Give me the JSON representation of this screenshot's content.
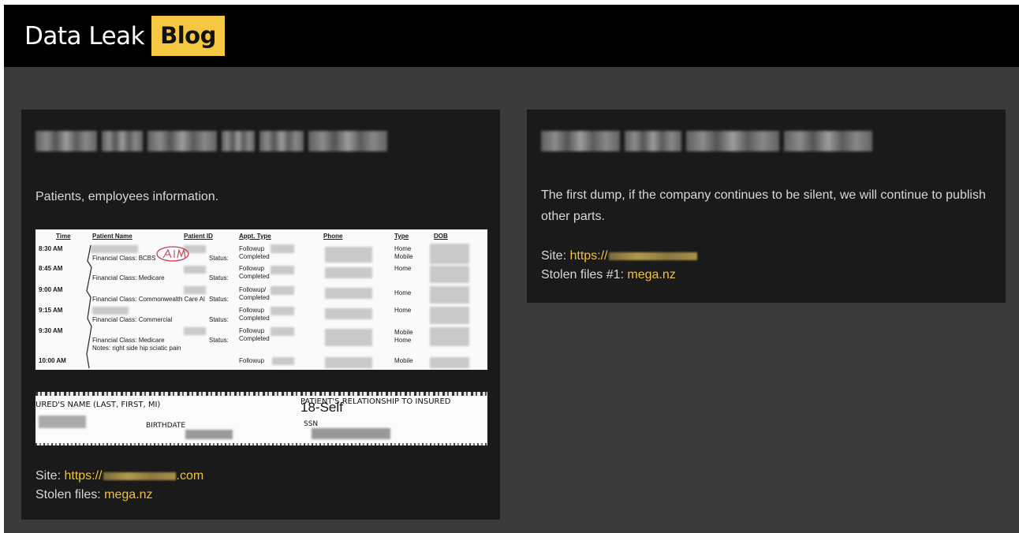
{
  "header": {
    "brand_word": "Data Leak",
    "brand_badge": "Blog"
  },
  "colors": {
    "accent": "#f5c842",
    "link": "#f2c23a",
    "page_bg": "#3b3b3b",
    "card_bg": "#1a1a1a",
    "header_bg": "#000000"
  },
  "posts": [
    {
      "description": "Patients, employees information.",
      "site_label": "Site:",
      "site_prefix": "https://",
      "site_suffix": ".com",
      "files_label": "Stolen files:",
      "files_link": "mega.nz",
      "doc_schedule": {
        "headers": {
          "time": "Time",
          "patient_name": "Patient Name",
          "patient_id": "Patient ID",
          "appt_type": "Appt. Type",
          "phone": "Phone",
          "type": "Type",
          "dob": "DOB"
        },
        "rows": [
          {
            "time": "8:30 AM",
            "fin_class": "Financial Class:  BCBS",
            "status": "Status:",
            "appt1": "Followup",
            "appt2": "Completed",
            "type1": "Home",
            "type2": "Mobile"
          },
          {
            "time": "8:45 AM",
            "fin_class": "Financial Class:  Medicare",
            "status": "Status:",
            "appt1": "Followup",
            "appt2": "Completed",
            "type1": "Home",
            "type2": ""
          },
          {
            "time": "9:00 AM",
            "fin_class": "Financial Class:  Commonwealth Care Al",
            "status": "Status:",
            "appt1": "Followup/",
            "appt2": "Completed",
            "type1": "Home",
            "type2": ""
          },
          {
            "time": "9:15 AM",
            "fin_class": "Financial Class:  Commercial",
            "status": "Status:",
            "appt1": "Followup",
            "appt2": "Completed",
            "type1": "Home",
            "type2": ""
          },
          {
            "time": "9:30 AM",
            "fin_class": "Financial Class:  Medicare",
            "status": "Status:",
            "appt1": "Followup",
            "appt2": "Completed",
            "type1": "Mobile",
            "type2": "Home"
          },
          {
            "time": "10:00 AM",
            "fin_class": "",
            "status": "",
            "appt1": "Followup",
            "appt2": "",
            "type1": "Mobile",
            "type2": ""
          }
        ],
        "note": "Notes:   right side hip sciatic pain"
      },
      "doc_insurance": {
        "insured_name": "URED'S NAME (LAST, FIRST, MI)",
        "relationship": "PATIENT'S RELATIONSHIP TO INSURED",
        "relationship_value": "18-Self",
        "birthdate": "BIRTHDATE",
        "ssn": "SSN"
      }
    },
    {
      "description": "The first dump, if the company continues to be silent, we will continue to publish other parts.",
      "site_label": "Site:",
      "site_prefix": "https://",
      "site_suffix": "",
      "files_label": "Stolen files #1:",
      "files_link": "mega.nz"
    }
  ]
}
